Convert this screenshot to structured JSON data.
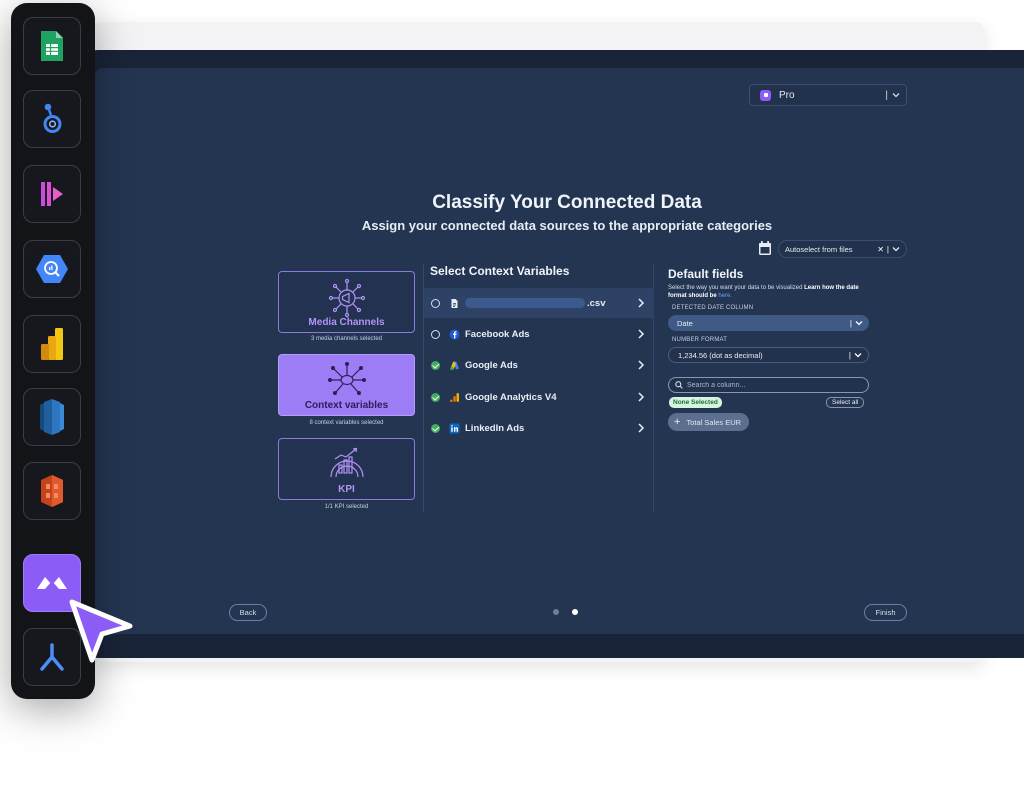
{
  "header": {
    "plan_select": {
      "value": "Pro"
    }
  },
  "title": "Classify Your Connected Data",
  "subtitle": "Assign your connected data sources to the appropriate categories",
  "autoselect": {
    "value": "Autoselect from files"
  },
  "categories": [
    {
      "label": "Media Channels",
      "sub": "3 media channels selected",
      "active": false,
      "icon": "megaphone-icon"
    },
    {
      "label": "Context variables",
      "sub": "8 context variables selected",
      "active": true,
      "icon": "network-icon"
    },
    {
      "label": "KPI",
      "sub": "1/1 KPI selected",
      "active": false,
      "icon": "gauge-icon"
    }
  ],
  "context_variables": {
    "title": "Select Context Variables",
    "items": [
      {
        "label": ".csv",
        "status": "unchecked",
        "icon": "file-icon"
      },
      {
        "label": "Facebook Ads",
        "status": "unchecked",
        "icon": "facebook-icon"
      },
      {
        "label": "Google Ads",
        "status": "checked",
        "icon": "google-ads-icon"
      },
      {
        "label": "Google Analytics V4",
        "status": "checked",
        "icon": "google-analytics-icon"
      },
      {
        "label": "LinkedIn Ads",
        "status": "checked",
        "icon": "linkedin-icon"
      }
    ]
  },
  "default_fields": {
    "title": "Default fields",
    "description": "Select the way you want your data to be visualized",
    "description_bold": "Learn how the date format should be",
    "description_link": "here.",
    "date_column_label": "DETECTED DATE COLUMN",
    "date_column_value": "Date",
    "number_format_label": "NUMBER FORMAT",
    "number_format_value": "1,234.56 (dot as decimal)",
    "search_placeholder": "Search a column...",
    "none_selected": "None Selected",
    "select_all": "Select all",
    "field_chip": "Total Sales EUR"
  },
  "footer": {
    "back": "Back",
    "finish": "Finish",
    "page": 2,
    "pages": 2
  },
  "colors": {
    "accent": "#8b5cf6",
    "background": "#243552",
    "check_green": "#3fae5e"
  },
  "dock": {
    "items": [
      {
        "name": "google-sheets-icon"
      },
      {
        "name": "looker-studio-icon"
      },
      {
        "name": "power-bi-alt-icon"
      },
      {
        "name": "bigquery-icon"
      },
      {
        "name": "power-bi-icon"
      },
      {
        "name": "redshift-icon"
      },
      {
        "name": "aws-s3-icon"
      },
      {
        "name": "app-logo-icon",
        "active": true
      },
      {
        "name": "airbyte-icon"
      }
    ]
  }
}
